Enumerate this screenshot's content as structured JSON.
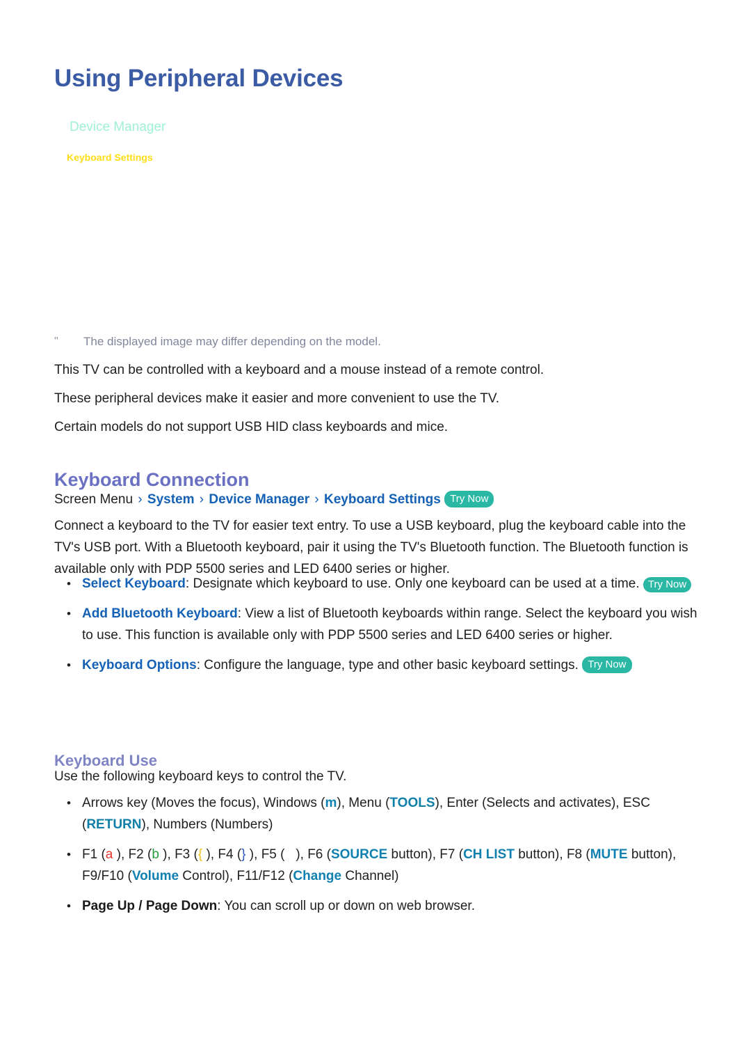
{
  "page": {
    "title": "Using Peripheral Devices"
  },
  "colors": {
    "page_title": "#3b5ba5",
    "section_heading": "#6a70c2",
    "sub_heading": "#7f84c4",
    "link_blue": "#1461b5",
    "keyword_teal": "#1080b0",
    "try_now_badge": "#2ab8a5",
    "note_text": "#82869b",
    "mock_panel_title": "#9ef0d6",
    "mock_panel_item": "#ffdd16",
    "glyph_a_red": "#e8342a",
    "glyph_b_green": "#1f9d3a",
    "glyph_brace_open_yellow": "#f0c21c",
    "glyph_brace_close_blue": "#2b56c8"
  },
  "mock_panel": {
    "title": "Device Manager",
    "item": "Keyboard Settings"
  },
  "note": {
    "marker": "\"",
    "text": "The displayed image may differ depending on the model."
  },
  "intro": {
    "lines": [
      "This TV can be controlled with a keyboard and a mouse instead of a remote control.",
      "These peripheral devices make it easier and more convenient to use the TV.",
      "Certain models do not support USB HID class keyboards and mice."
    ]
  },
  "keyboard_connection": {
    "heading": "Keyboard Connection",
    "breadcrumb": {
      "root": "Screen Menu",
      "separator": "›",
      "links": [
        "System",
        "Device Manager",
        "Keyboard Settings"
      ],
      "badge": "Try Now"
    },
    "paragraph": "Connect a keyboard to the TV for easier text entry. To use a USB keyboard, plug the keyboard cable into the TV's USB port. With a Bluetooth keyboard, pair it using the TV's Bluetooth function. The Bluetooth function is available only with PDP 5500 series and LED 6400 series or higher.",
    "bullets": [
      {
        "term": "Select Keyboard",
        "separator": ":",
        "text": "Designate which keyboard to use. Only one keyboard can be used at a time.",
        "badge": "Try Now"
      },
      {
        "term": "Add Bluetooth Keyboard",
        "separator": ":",
        "text": "View a list of Bluetooth keyboards within range. Select the keyboard you wish to use. This function is available only with PDP 5500 series and LED 6400 series or higher.",
        "badge": ""
      },
      {
        "term": "Keyboard Options",
        "separator": ":",
        "text": "Configure the language, type and other basic keyboard settings.",
        "badge": "Try Now"
      }
    ]
  },
  "keyboard_use": {
    "heading": "Keyboard Use",
    "paragraph": "Use the following keyboard keys to control the TV.",
    "bullet_arrows": {
      "prefix": "Arrows key (Moves the focus), Windows (",
      "windows_glyph": "m",
      "mid1": "), Menu (",
      "tools": "TOOLS",
      "mid2": "), Enter (Selects and activates), ESC (",
      "return": "RETURN",
      "suffix": "), Numbers (Numbers)"
    },
    "bullet_fkeys": {
      "f1_label": "F1 (",
      "f1_glyph": "a",
      "f1_close": " ), ",
      "f2_label": "F2 (",
      "f2_glyph": "b",
      "f2_close": " ), ",
      "f3_label": "F3 (",
      "f3_glyph": "{",
      "f3_close": " ), ",
      "f4_label": "F4 (",
      "f4_glyph": "}",
      "f4_close": " ), ",
      "f5_label": "F5 (",
      "f5_glyph": "   ",
      "f5_close": "), ",
      "f6_label": "F6 (",
      "f6_key": "SOURCE",
      "f6_close": " button), ",
      "f7_label": "F7 (",
      "f7_key": "CH LIST",
      "f7_close": " button), ",
      "f8_label": "F8 (",
      "f8_key": "MUTE",
      "f8_close": " button), ",
      "f9_label": "F9/F10 (",
      "f9_key": "Volume",
      "f9_close": " Control), ",
      "f11_label": "F11/F12 (",
      "f11_key": "Change",
      "f11_close": " Channel)"
    },
    "bullet_page": {
      "term": "Page Up / Page Down",
      "separator": ":",
      "text": "You can scroll up or down on web browser."
    }
  }
}
